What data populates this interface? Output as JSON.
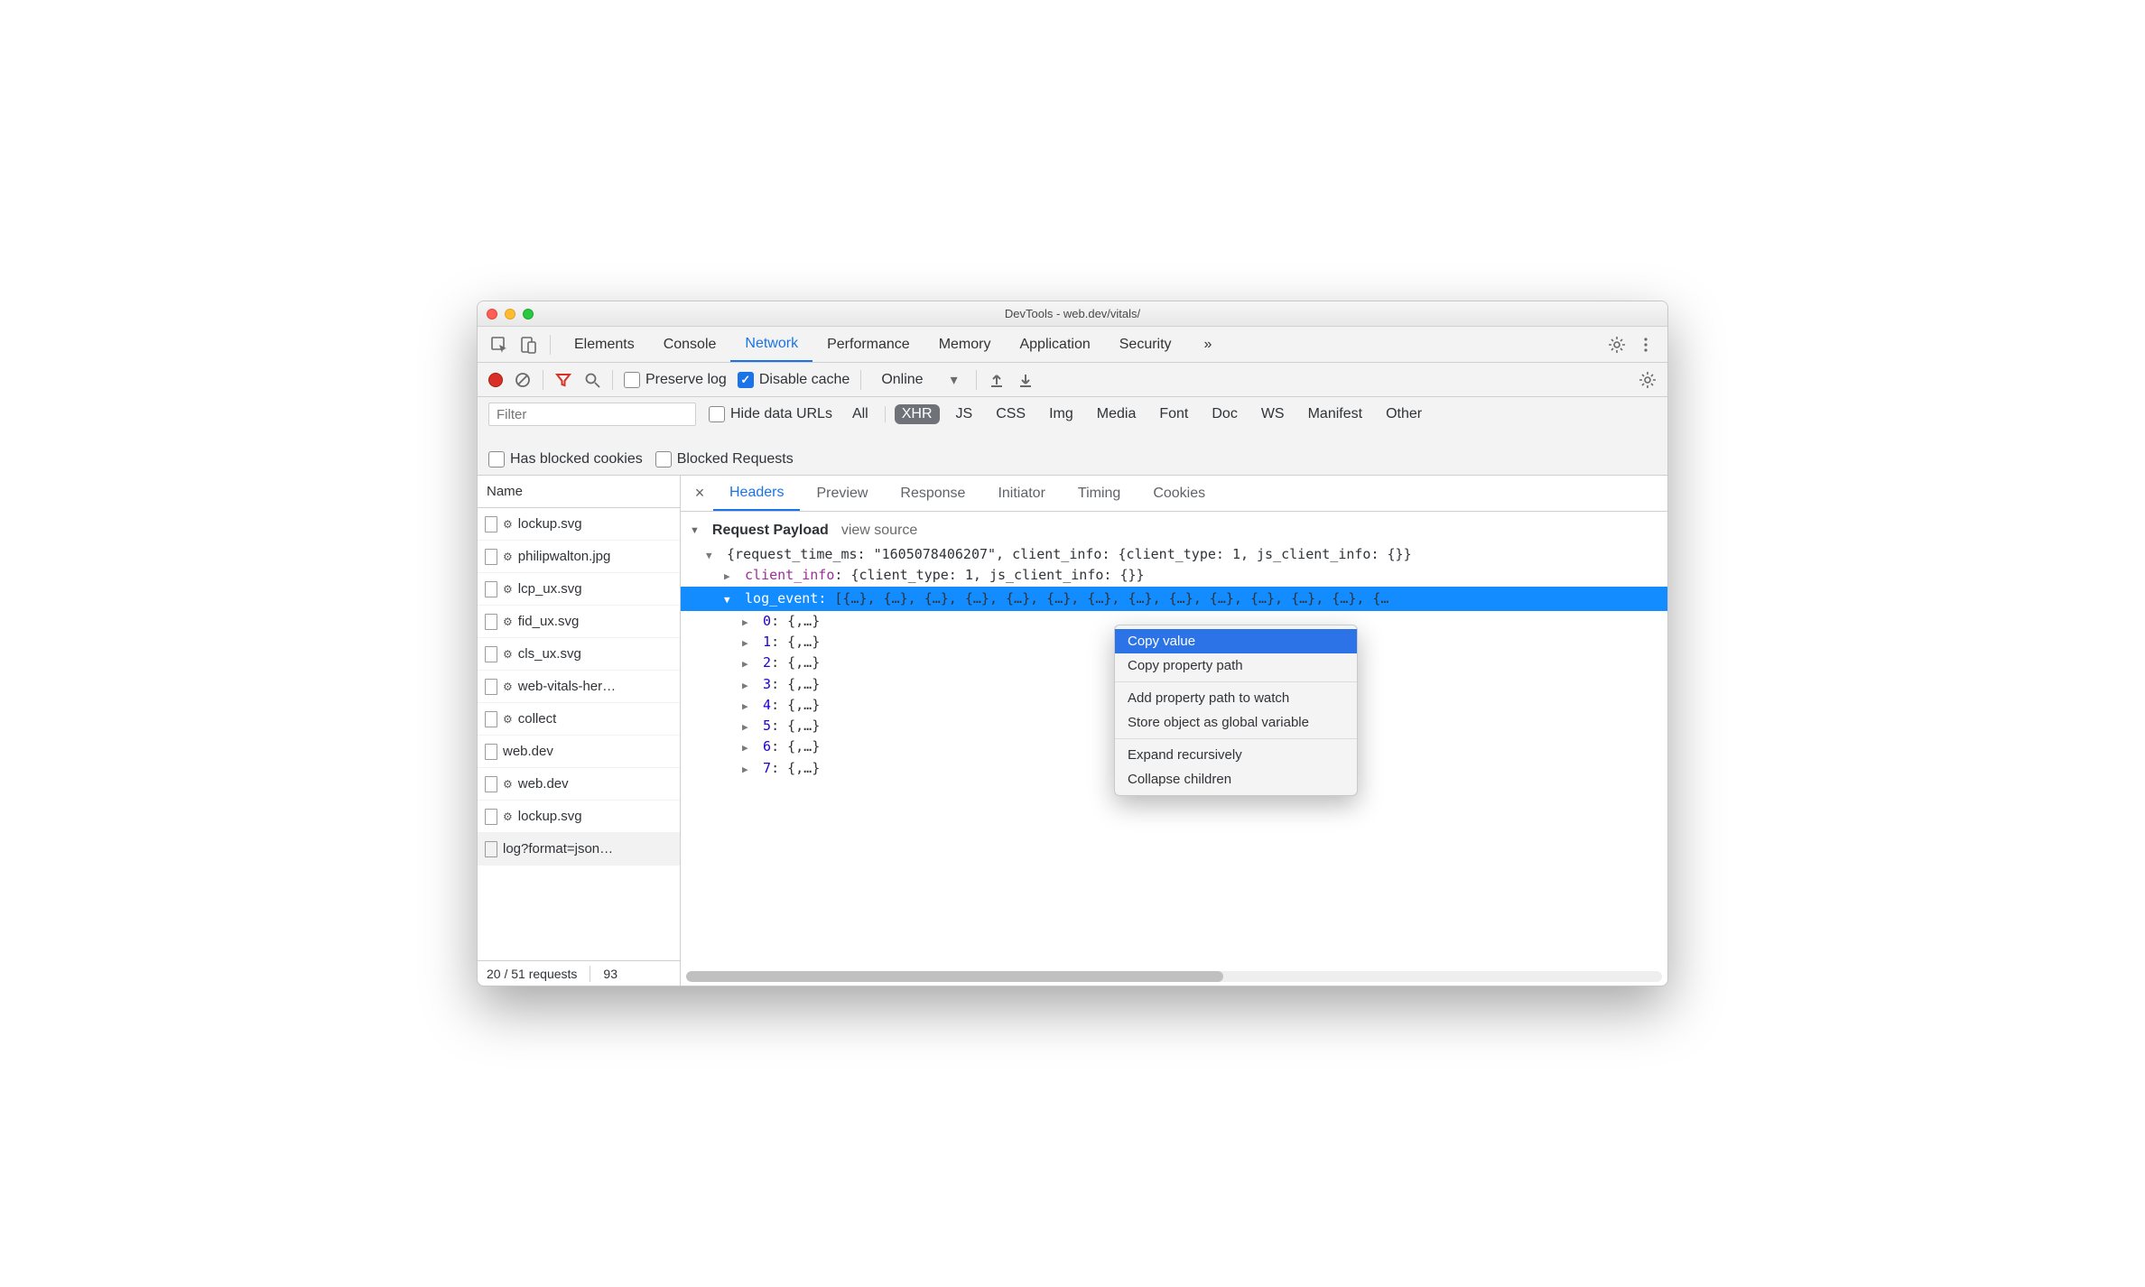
{
  "window": {
    "title": "DevTools - web.dev/vitals/"
  },
  "main_tabs": {
    "items": [
      "Elements",
      "Console",
      "Network",
      "Performance",
      "Memory",
      "Application",
      "Security"
    ],
    "active": "Network",
    "overflow_symbol": "»"
  },
  "toolbar": {
    "preserve_log_label": "Preserve log",
    "preserve_log_checked": false,
    "disable_cache_label": "Disable cache",
    "disable_cache_checked": true,
    "throttle_value": "Online"
  },
  "filterrow": {
    "filter_placeholder": "Filter",
    "hide_data_urls_label": "Hide data URLs",
    "types": [
      "All",
      "XHR",
      "JS",
      "CSS",
      "Img",
      "Media",
      "Font",
      "Doc",
      "WS",
      "Manifest",
      "Other"
    ],
    "active_type": "XHR",
    "has_blocked_cookies_label": "Has blocked cookies",
    "blocked_requests_label": "Blocked Requests"
  },
  "sidebar": {
    "header": "Name",
    "files": [
      {
        "name": "lockup.svg",
        "gear": true
      },
      {
        "name": "philipwalton.jpg",
        "gear": true
      },
      {
        "name": "lcp_ux.svg",
        "gear": true
      },
      {
        "name": "fid_ux.svg",
        "gear": true
      },
      {
        "name": "cls_ux.svg",
        "gear": true
      },
      {
        "name": "web-vitals-her…",
        "gear": true
      },
      {
        "name": "collect",
        "gear": true
      },
      {
        "name": "web.dev",
        "gear": false
      },
      {
        "name": "web.dev",
        "gear": true
      },
      {
        "name": "lockup.svg",
        "gear": true
      },
      {
        "name": "log?format=json…",
        "gear": false,
        "selected": true
      }
    ],
    "footer_requests": "20 / 51 requests",
    "footer_extra": "93"
  },
  "detail": {
    "subtabs": [
      "Headers",
      "Preview",
      "Response",
      "Initiator",
      "Timing",
      "Cookies"
    ],
    "active_subtab": "Headers",
    "section_title": "Request Payload",
    "section_view_source": "view source",
    "root_line": "{request_time_ms: \"1605078406207\", client_info: {client_type: 1, js_client_info: {}}",
    "client_info_key": "client_info",
    "client_info_val": "{client_type: 1, js_client_info: {}}",
    "log_event_key": "log_event",
    "log_event_val": "[{…}, {…}, {…}, {…}, {…}, {…}, {…}, {…}, {…}, {…}, {…}, {…}, {…}, {…",
    "log_event_items": [
      {
        "idx": "0",
        "val": "{,…}"
      },
      {
        "idx": "1",
        "val": "{,…}"
      },
      {
        "idx": "2",
        "val": "{,…}"
      },
      {
        "idx": "3",
        "val": "{,…}"
      },
      {
        "idx": "4",
        "val": "{,…}"
      },
      {
        "idx": "5",
        "val": "{,…}"
      },
      {
        "idx": "6",
        "val": "{,…}"
      },
      {
        "idx": "7",
        "val": "{,…}"
      }
    ]
  },
  "context_menu": {
    "items": [
      {
        "label": "Copy value",
        "highlight": true
      },
      {
        "label": "Copy property path"
      },
      {
        "sep": true
      },
      {
        "label": "Add property path to watch"
      },
      {
        "label": "Store object as global variable"
      },
      {
        "sep": true
      },
      {
        "label": "Expand recursively"
      },
      {
        "label": "Collapse children"
      }
    ]
  }
}
